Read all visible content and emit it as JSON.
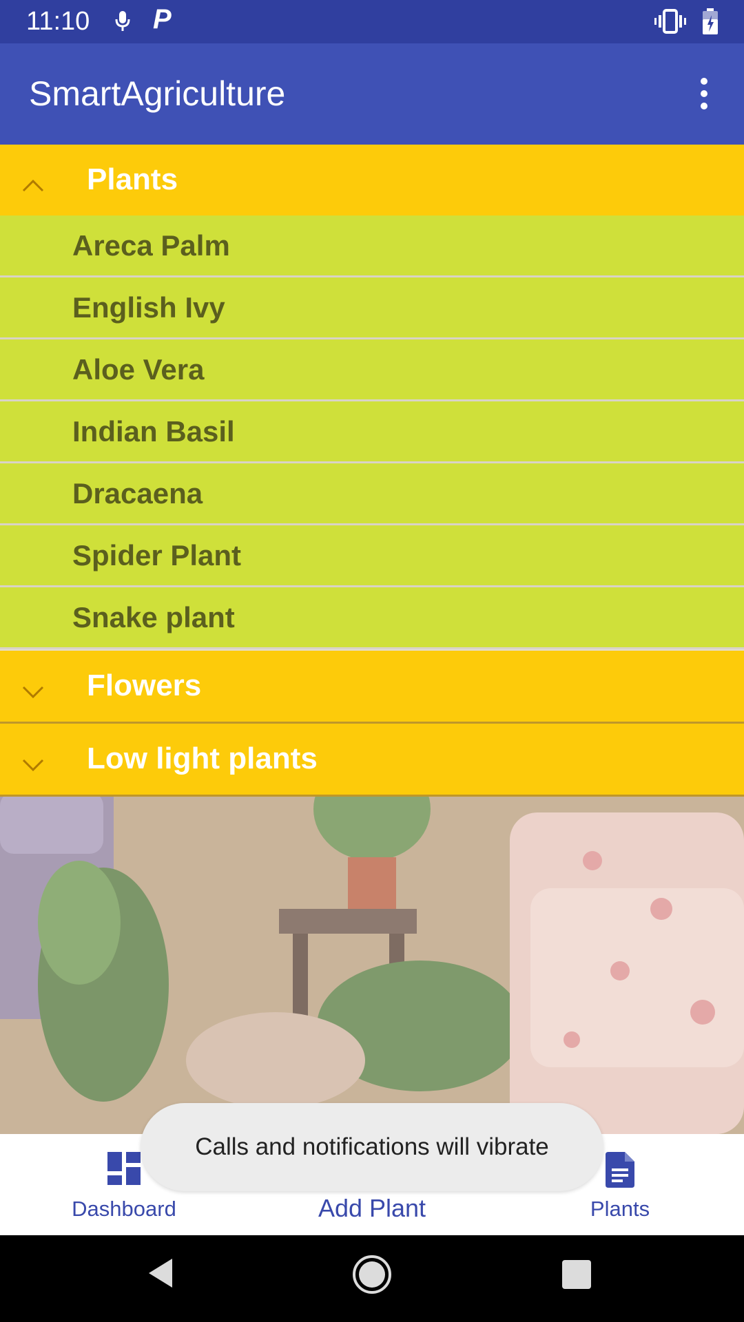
{
  "status_bar": {
    "time": "11:10",
    "icons": [
      "mic-icon",
      "p-icon",
      "vibrate-icon",
      "battery-icon"
    ]
  },
  "app_bar": {
    "title": "SmartAgriculture",
    "menu_icon": "more-vert-icon"
  },
  "groups": [
    {
      "label": "Plants",
      "expanded": true,
      "items": [
        "Areca Palm",
        "English Ivy",
        "Aloe Vera",
        "Indian Basil",
        "Dracaena",
        "Spider Plant",
        "Snake plant"
      ]
    },
    {
      "label": "Flowers",
      "expanded": false,
      "items": []
    },
    {
      "label": "Low light plants",
      "expanded": false,
      "items": []
    }
  ],
  "bottom_nav": {
    "dashboard_label": "Dashboard",
    "add_label": "Add Plant",
    "plants_label": "Plants"
  },
  "toast": {
    "message": "Calls and notifications will vibrate"
  },
  "colors": {
    "status_bar": "#303f9f",
    "app_bar": "#3f51b5",
    "group_header": "#fdcb0a",
    "child_item": "#cfe03a",
    "nav_accent": "#3949ab"
  }
}
